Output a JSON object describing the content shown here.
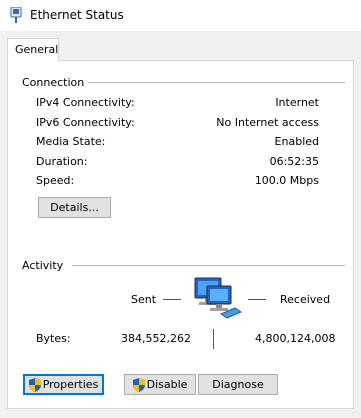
{
  "window": {
    "title": "Ethernet Status"
  },
  "tabs": [
    {
      "label": "General"
    }
  ],
  "connection": {
    "heading": "Connection",
    "rows": [
      {
        "label": "IPv4 Connectivity:",
        "value": "Internet"
      },
      {
        "label": "IPv6 Connectivity:",
        "value": "No Internet access"
      },
      {
        "label": "Media State:",
        "value": "Enabled"
      },
      {
        "label": "Duration:",
        "value": "06:52:35"
      },
      {
        "label": "Speed:",
        "value": "100.0 Mbps"
      }
    ],
    "details_button": "Details..."
  },
  "activity": {
    "heading": "Activity",
    "sent_label": "Sent",
    "received_label": "Received",
    "bytes_label": "Bytes:",
    "bytes_sent": "384,552,262",
    "bytes_received": "4,800,124,008"
  },
  "buttons": {
    "properties": "Properties",
    "disable": "Disable",
    "diagnose": "Diagnose"
  },
  "icons": {
    "title": "network-adapter-icon",
    "activity": "network-computers-icon",
    "shield": "uac-shield-icon"
  },
  "colors": {
    "accent": "#0078d7",
    "shield_blue": "#1f5fbf",
    "shield_yellow": "#f2c200"
  }
}
